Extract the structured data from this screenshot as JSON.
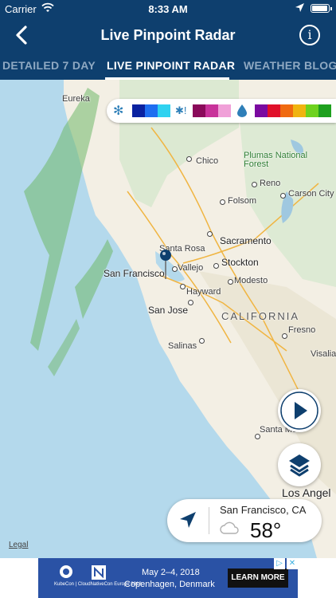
{
  "status_bar": {
    "carrier": "Carrier",
    "time": "8:33 AM"
  },
  "nav": {
    "title": "Live Pinpoint Radar",
    "info_glyph": "i"
  },
  "tabs": [
    {
      "label": "DETAILED 7 DAY",
      "active": false
    },
    {
      "label": "LIVE PINPOINT RADAR",
      "active": true
    },
    {
      "label": "WEATHER BLOG",
      "active": false
    }
  ],
  "legend": {
    "snow_icon": "snowflake-icon",
    "mix_icon": "mix-icon",
    "rain_icon": "raindrop-icon",
    "snow_colors": [
      "#0a22a0",
      "#1e6ef0",
      "#2fd2f0"
    ],
    "mix_colors": [
      "#8a0a5a",
      "#c8329a",
      "#f0a0d8"
    ],
    "rain_colors": [
      "#7a0aa0",
      "#e0102a",
      "#f06a10",
      "#f0b410",
      "#6ed21e",
      "#1ea01e"
    ]
  },
  "map": {
    "cities": [
      {
        "name": "Eureka"
      },
      {
        "name": "Chico"
      },
      {
        "name": "Plumas National"
      },
      {
        "name": "Forest"
      },
      {
        "name": "Reno"
      },
      {
        "name": "Carson City"
      },
      {
        "name": "Folsom"
      },
      {
        "name": "Sacramento"
      },
      {
        "name": "Santa Rosa"
      },
      {
        "name": "Stockton"
      },
      {
        "name": "San Francisco"
      },
      {
        "name": "Vallejo"
      },
      {
        "name": "Modesto"
      },
      {
        "name": "Hayward"
      },
      {
        "name": "San Jose"
      },
      {
        "name": "CALIFORNIA"
      },
      {
        "name": "Fresno"
      },
      {
        "name": "Salinas"
      },
      {
        "name": "Visalia"
      },
      {
        "name": "Santa Mon"
      },
      {
        "name": "Los Angel"
      }
    ],
    "legal": "Legal"
  },
  "controls": {
    "play_icon": "play-icon",
    "layers_icon": "layers-icon"
  },
  "location_card": {
    "place": "San Francisco, CA",
    "temp": "58°",
    "condition_icon": "cloud-icon"
  },
  "ad": {
    "brand": "KubeCon | CloudNativeCon Europe 2018",
    "line1": "May 2–4, 2018",
    "line2": "Copenhagen, Denmark",
    "cta": "LEARN MORE",
    "adchoices": "▷",
    "close": "✕"
  }
}
